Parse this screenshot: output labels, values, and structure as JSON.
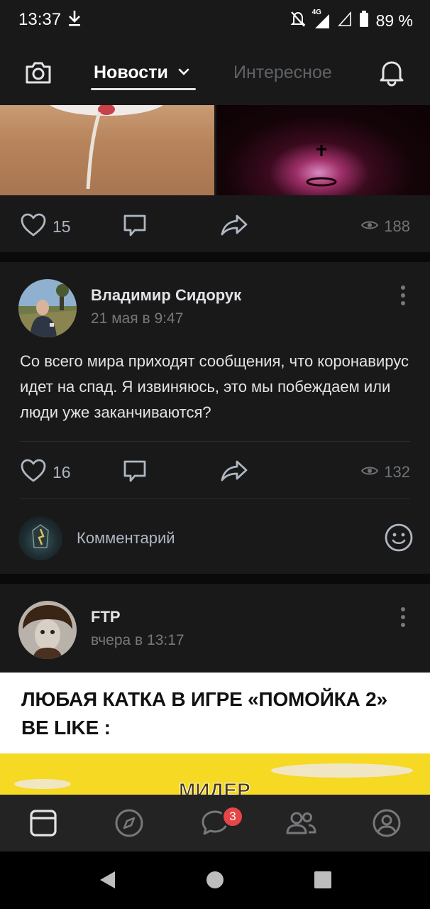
{
  "status_bar": {
    "time": "13:37",
    "network": "4G",
    "battery": "89 %"
  },
  "header": {
    "tab_news": "Новости",
    "tab_interesting": "Интересное"
  },
  "posts": [
    {
      "likes": "15",
      "views": "188"
    },
    {
      "author": "Владимир Сидорук",
      "date": "21 мая в 9:47",
      "text": "Со всего мира приходят сообщения, что коронавирус идет на спад. Я извиняюсь, это мы побеждаем или люди уже заканчиваются?",
      "likes": "16",
      "views": "132",
      "comment_placeholder": "Комментарий"
    },
    {
      "author": "FTP",
      "date": "вчера в 13:17",
      "meme_text": "ЛЮБАЯ КАТКА В ИГРЕ «ПОМОЙКА 2» BE LIKE :",
      "meme_partial_word": "МИДЕР"
    }
  ],
  "bottom_nav": {
    "items": [
      "news-icon",
      "discover-icon",
      "messages-icon",
      "friends-icon",
      "profile-icon"
    ],
    "messages_badge": "3"
  },
  "colors": {
    "background": "#0a0a0a",
    "card": "#191919",
    "accent_badge": "#e64646",
    "muted_text": "#76787a"
  }
}
